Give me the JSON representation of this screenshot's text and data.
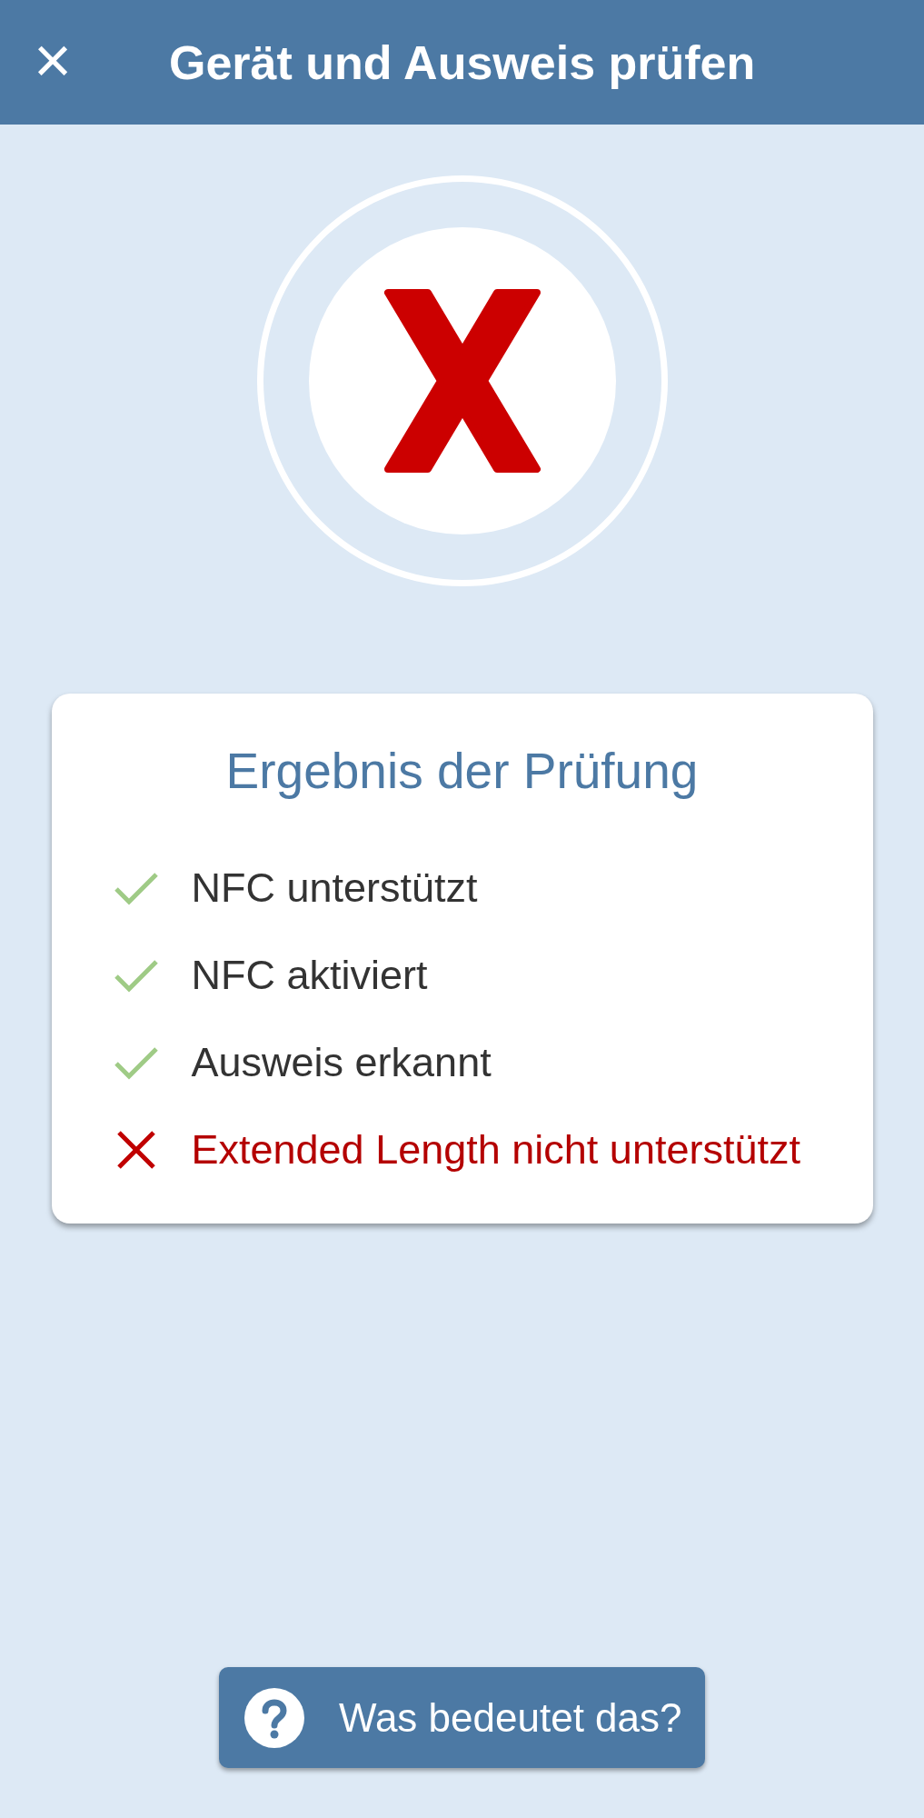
{
  "header": {
    "close_icon": "×",
    "title": "Gerät und Ausweis prüfen"
  },
  "result": {
    "failed": true
  },
  "card": {
    "title": "Ergebnis der Prüfung",
    "items": [
      {
        "label": "NFC unterstützt",
        "passed": true
      },
      {
        "label": "NFC aktiviert",
        "passed": true
      },
      {
        "label": "Ausweis erkannt",
        "passed": true
      },
      {
        "label": "Extended Length nicht unterstützt",
        "passed": false
      }
    ]
  },
  "help_button": {
    "label": "Was bedeutet das?"
  }
}
